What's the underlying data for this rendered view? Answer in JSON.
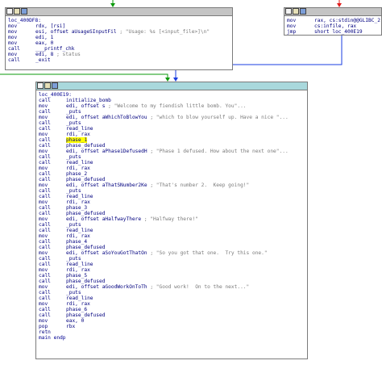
{
  "colors": {
    "edge_green": "#0b9a0b",
    "edge_red": "#e21b1b",
    "edge_blue": "#1a3de0",
    "node_title_main": "#a9d8dc",
    "node_title_other": "#c4c4c4",
    "highlight": "#ffff00"
  },
  "icons": [
    "window-icon",
    "graph-icon",
    "list-icon"
  ],
  "node_left": {
    "lines": [
      {
        "label": "loc_400DF8:"
      },
      {
        "mn": "mov",
        "op": "rdx, [rsi]"
      },
      {
        "mn": "mov",
        "op": "esi, offset aUsageSInputFil",
        "cm": "; \"Usage: %s [<input_file>]\\n\""
      },
      {
        "mn": "mov",
        "op": "edi, 1"
      },
      {
        "mn": "mov",
        "op": "eax, 0"
      },
      {
        "mn": "call",
        "op": "___printf_chk"
      },
      {
        "mn": "mov",
        "op": "edi, 8",
        "cm": "; status"
      },
      {
        "mn": "call",
        "op": "_exit"
      }
    ]
  },
  "node_right": {
    "lines": [
      {
        "mn": "mov",
        "op": "rax, cs:stdin@@GLIBC_2"
      },
      {
        "mn": "mov",
        "op": "cs:infile, rax"
      },
      {
        "mn": "jmp",
        "op": "short loc_400E19"
      }
    ]
  },
  "node_main": {
    "lines": [
      {
        "label": "loc_400E19:"
      },
      {
        "mn": "call",
        "op": "initialize_bomb"
      },
      {
        "mn": "mov",
        "op": "edi, offset s",
        "cm": "; \"Welcome to my fiendish little bomb. You\"..."
      },
      {
        "mn": "call",
        "op": "_puts"
      },
      {
        "mn": "mov",
        "op": "edi, offset aWhichToBlowYou",
        "cm": "; \"which to blow yourself up. Have a nice \"..."
      },
      {
        "mn": "call",
        "op": "_puts"
      },
      {
        "mn": "call",
        "op": "read_line"
      },
      {
        "mn": "mov",
        "op": "rdi, rax"
      },
      {
        "mn": "call",
        "op": "phase_1",
        "hl": true
      },
      {
        "mn": "call",
        "op": "phase_defused"
      },
      {
        "mn": "mov",
        "op": "edi, offset aPhase1DefusedH",
        "cm": "; \"Phase 1 defused. How about the next one\"..."
      },
      {
        "mn": "call",
        "op": "_puts"
      },
      {
        "mn": "call",
        "op": "read_line"
      },
      {
        "mn": "mov",
        "op": "rdi, rax"
      },
      {
        "mn": "call",
        "op": "phase_2"
      },
      {
        "mn": "call",
        "op": "phase_defused"
      },
      {
        "mn": "mov",
        "op": "edi, offset aThatSNumber2Ke",
        "cm": "; \"That's number 2.  Keep going!\""
      },
      {
        "mn": "call",
        "op": "_puts"
      },
      {
        "mn": "call",
        "op": "read_line"
      },
      {
        "mn": "mov",
        "op": "rdi, rax"
      },
      {
        "mn": "call",
        "op": "phase_3"
      },
      {
        "mn": "call",
        "op": "phase_defused"
      },
      {
        "mn": "mov",
        "op": "edi, offset aHalfwayThere",
        "cm": "; \"Halfway there!\""
      },
      {
        "mn": "call",
        "op": "_puts"
      },
      {
        "mn": "call",
        "op": "read_line"
      },
      {
        "mn": "mov",
        "op": "rdi, rax"
      },
      {
        "mn": "call",
        "op": "phase_4"
      },
      {
        "mn": "call",
        "op": "phase_defused"
      },
      {
        "mn": "mov",
        "op": "edi, offset aSoYouGotThatOn",
        "cm": "; \"So you got that one.  Try this one.\""
      },
      {
        "mn": "call",
        "op": "_puts"
      },
      {
        "mn": "call",
        "op": "read_line"
      },
      {
        "mn": "mov",
        "op": "rdi, rax"
      },
      {
        "mn": "call",
        "op": "phase_5"
      },
      {
        "mn": "call",
        "op": "phase_defused"
      },
      {
        "mn": "mov",
        "op": "edi, offset aGoodWorkOnToTh",
        "cm": "; \"Good work!  On to the next...\""
      },
      {
        "mn": "call",
        "op": "_puts"
      },
      {
        "mn": "call",
        "op": "read_line"
      },
      {
        "mn": "mov",
        "op": "rdi, rax"
      },
      {
        "mn": "call",
        "op": "phase_6"
      },
      {
        "mn": "call",
        "op": "phase_defused"
      },
      {
        "mn": "mov",
        "op": "eax, 0"
      },
      {
        "mn": "pop",
        "op": "rbx"
      },
      {
        "mn": "retn",
        "op": ""
      },
      {
        "label": "main endp"
      }
    ]
  }
}
